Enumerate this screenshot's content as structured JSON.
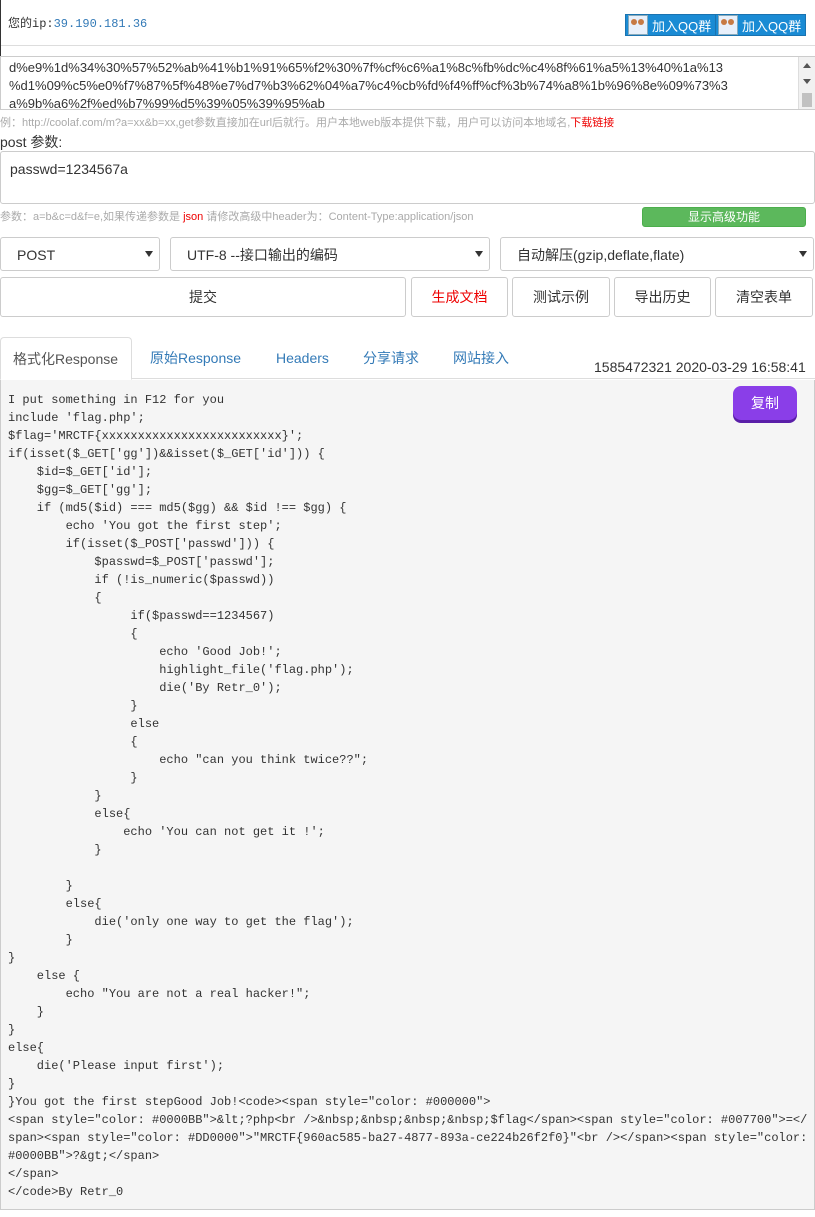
{
  "ipbar": {
    "label": "您的ip:",
    "ip": "39.190.181.36",
    "qq_btn1": "加入QQ群",
    "qq_btn2": "加入QQ群"
  },
  "url": {
    "text_lines": [
      "d%e9%1d%34%30%57%52%ab%41%b1%91%65%f2%30%7f%cf%c6%a1%8c%fb%dc%c4%8f%61%a5%13%40%1a%13",
      "%d1%09%c5%e0%f7%87%5f%48%e7%d7%b3%62%04%a7%c4%cb%fd%f4%ff%cf%3b%74%a8%1b%96%8e%09%73%3",
      "a%9b%a6%2f%ed%b7%99%d5%39%05%39%95%ab"
    ],
    "hint": "例：http://coolaf.com/m?a=xx&b=xx,get参数直接加在url后就行。用户本地web版本提供下载，用户可以访问本地域名,",
    "download_link": "下载链接"
  },
  "post": {
    "label": "post 参数:",
    "value": "passwd=1234567a",
    "hint_before": "参数：a=b&c=d&f=e,如果传递参数是 ",
    "hint_json": "json",
    "hint_after": " 请修改高级中header为：Content-Type:application/json",
    "advanced_button": "显示高级功能"
  },
  "selects": {
    "method": "POST",
    "encoding": "UTF-8 --接口输出的编码",
    "decompress": "自动解压(gzip,deflate,flate)"
  },
  "buttons": {
    "submit": "提交",
    "gen_doc": "生成文档",
    "test_example": "测试示例",
    "export_history": "导出历史",
    "clear_form": "清空表单"
  },
  "tabs": [
    "格式化Response",
    "原始Response",
    "Headers",
    "分享请求",
    "网站接入"
  ],
  "timestamp": "1585472321 2020-03-29 16:58:41",
  "copy_button": "复制",
  "response": "I put something in F12 for you\ninclude 'flag.php';\n$flag='MRCTF{xxxxxxxxxxxxxxxxxxxxxxxxx}';\nif(isset($_GET['gg'])&&isset($_GET['id'])) {\n    $id=$_GET['id'];\n    $gg=$_GET['gg'];\n    if (md5($id) === md5($gg) && $id !== $gg) {\n        echo 'You got the first step';\n        if(isset($_POST['passwd'])) {\n            $passwd=$_POST['passwd'];\n            if (!is_numeric($passwd))\n            {\n                 if($passwd==1234567)\n                 {\n                     echo 'Good Job!';\n                     highlight_file('flag.php');\n                     die('By Retr_0');\n                 }\n                 else\n                 {\n                     echo \"can you think twice??\";\n                 }\n            }\n            else{\n                echo 'You can not get it !';\n            }\n\n        }\n        else{\n            die('only one way to get the flag');\n        }\n}\n    else {\n        echo \"You are not a real hacker!\";\n    }\n}\nelse{\n    die('Please input first');\n}\n}You got the first stepGood Job!<code><span style=\"color: #000000\">\n<span style=\"color: #0000BB\">&lt;?php<br />&nbsp;&nbsp;&nbsp;&nbsp;$flag</span><span style=\"color: #007700\">=</\nspan><span style=\"color: #DD0000\">\"MRCTF{960ac585-ba27-4877-893a-ce224b26f2f0}\"<br /></span><span style=\"color:\n#0000BB\">?&gt;</span>\n</span>\n</code>By Retr_0"
}
